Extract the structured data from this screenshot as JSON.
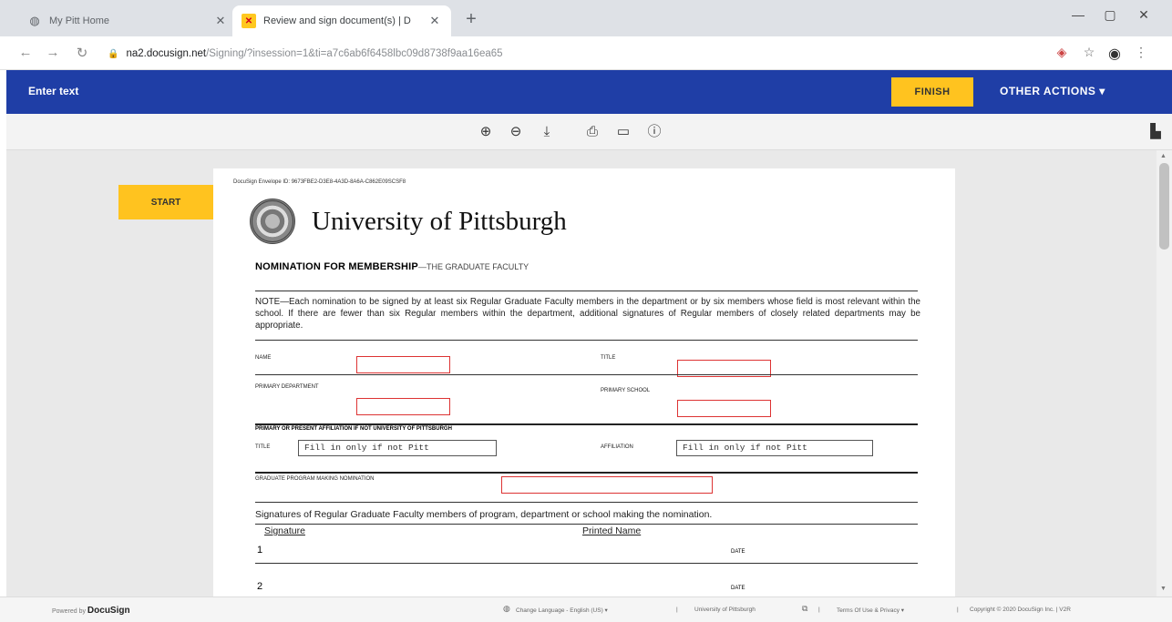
{
  "browser": {
    "tabs": [
      {
        "title": "My Pitt Home",
        "icon": "globe-icon"
      },
      {
        "title": "Review and sign document(s) | D",
        "icon": "docusign-icon"
      }
    ],
    "url_host": "na2.docusign.net",
    "url_path": "/Signing/?insession=1&ti=a7c6ab6f6458lbc09d8738f9aa16ea65"
  },
  "docusign": {
    "message": "Enter text",
    "finish_label": "FINISH",
    "other_actions_label": "OTHER ACTIONS ▾",
    "start_label": "START"
  },
  "document": {
    "envelope_id": "DocuSign Envelope ID: 9673FBE2-D3E8-4A3D-8A6A-C862E09SCSF8",
    "university": "University of Pittsburgh",
    "form_title_bold": "NOMINATION FOR MEMBERSHIP",
    "form_title_rest": "—THE GRADUATE FACULTY",
    "note": "NOTE—Each nomination to be signed by at least six Regular Graduate Faculty members in the department or by six members whose field is most relevant within the school. If there are fewer than six Regular members within the department, additional signatures of Regular members of closely related departments may be appropriate.",
    "labels": {
      "name": "NAME",
      "title": "TITLE",
      "primary_department": "PRIMARY DEPARTMENT",
      "primary_school": "PRIMARY SCHOOL",
      "affiliation_header": "PRIMARY OR PRESENT AFFILIATION IF NOT UNIVERSITY OF PITTSBURGH",
      "title2": "TITLE",
      "affiliation": "AFFILIATION",
      "graduate_program": "GRADUATE PROGRAM MAKING NOMINATION",
      "signature": "Signature",
      "printed_name": "Printed Name",
      "date": "DATE"
    },
    "title_field_value": "Fill in only if not Pitt",
    "affiliation_field_value": "Fill in only if not Pitt",
    "signatures_text": "Signatures of Regular Graduate Faculty members of program, department or school making the nomination.",
    "row_numbers": [
      "1",
      "2"
    ]
  },
  "footer": {
    "powered_by": "Powered by",
    "brand": "DocuSign",
    "change_language": "Change Language - English (US) ▾",
    "university_link": "University of Pittsburgh",
    "terms": "Terms Of Use & Privacy ▾",
    "copyright": "Copyright © 2020 DocuSign Inc. | V2R"
  }
}
